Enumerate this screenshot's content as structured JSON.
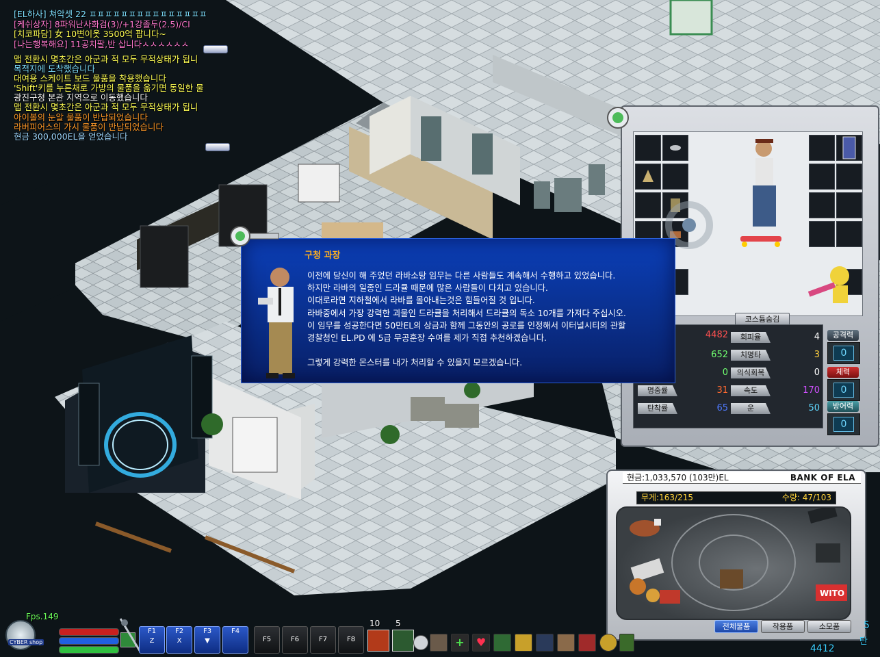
{
  "chat": {
    "player_lines": [
      {
        "text": "[EL하사] 쳐악셋 22 ㅍㅍㅍㅍㅍㅍㅍㅍㅍㅍㅍㅍㅍㅍㅍ",
        "color": "#7fe0ff"
      },
      {
        "text": "[케쉬상자] 8파워난사화검(3)/+1강졸두(2.5)/CI",
        "color": "#ff7ad0"
      },
      {
        "text": "[치코파담] 女 10변이옷 3500억 팝니다~",
        "color": "#ffff55"
      },
      {
        "text": "[나는행복해요] 11공치팔,반 삽니다ㅅㅅㅅㅅㅅㅅ",
        "color": "#ff7ad0"
      }
    ],
    "system_lines": [
      {
        "text": "맵 전환시 몇초간은 아군과 적 모두 무적상태가 됩니",
        "color": "#ffff55"
      },
      {
        "text": "목적지에 도착했습니다",
        "color": "#7fe0ff"
      },
      {
        "text": "대여용 스케이트 보드 물품을 착용했습니다",
        "color": "#ffff55"
      },
      {
        "text": "'Shift'키를 누른채로 가방의 물품을 옮기면 동일한 물",
        "color": "#ffff55"
      },
      {
        "text": "광진구청 본관 지역으로 이동했습니다",
        "color": "#ffffff"
      },
      {
        "text": "맵 전환시 몇초간은 아군과 적 모두 무적상태가 됩니",
        "color": "#ffff55"
      },
      {
        "text": "아이볼의 눈알 물품이 반납되었습니다",
        "color": "#ff9a2a"
      },
      {
        "text": "라버피어스의 가시 물품이 반납되었습니다",
        "color": "#ff9a2a"
      },
      {
        "text": "현금 300,000EL을 얻었습니다",
        "color": "#9fd8ff"
      }
    ]
  },
  "quest_dialog": {
    "title": "구청 과장",
    "lines": [
      "이전에 당신이 해 주었던 라바소탕 임무는 다른 사람들도 계속해서 수행하고 있었습니다.",
      "하지만 라바의 일종인 드라큘 때문에 많은 사람들이 다치고 있습니다.",
      "이대로라면 지하철에서 라바를 몰아내는것은 힘들어질 것 입니다.",
      "라바중에서 가장 강력한 괴물인 드라큘을 처리해서 드라큘의 독소 10개를 가져다 주십시오.",
      "이 임무를 성공한다면 50만EL의 상금과 함께 그동안의 공로를 인정해서 이터널시티의 관할",
      "경찰청인 EL.PD 에 5급 무공훈장 수여를 제가 직접 추천하겠습니다.",
      "",
      "그렇게 강력한 몬스터를 내가 처리할 수 있을지 모르겠습니다."
    ]
  },
  "character_window": {
    "costume_button": "코스튬숨김",
    "left_stats": [
      {
        "label": "",
        "value": "4482",
        "color": "#ff5050"
      },
      {
        "label": "",
        "value": "652",
        "color": "#70ff70"
      },
      {
        "label": "",
        "value": "0",
        "color": "#70ff70"
      },
      {
        "label": "명중률",
        "value": "31",
        "color": "#ff6a30"
      },
      {
        "label": "탄착률",
        "value": "65",
        "color": "#4f7aff"
      }
    ],
    "mid_stats": [
      {
        "label": "회피율",
        "value": "4",
        "color": "#ffffff"
      },
      {
        "label": "치명타",
        "value": "3",
        "color": "#ffd040"
      },
      {
        "label": "의식회복",
        "value": "0",
        "color": "#ffffff"
      },
      {
        "label": "속도",
        "value": "170",
        "color": "#d050ff"
      },
      {
        "label": "운",
        "value": "50",
        "color": "#60d8ff"
      }
    ],
    "right_stats": [
      {
        "label": "공격력",
        "value": "0"
      },
      {
        "label": "체력",
        "value": "0"
      },
      {
        "label": "방어력",
        "value": "0"
      }
    ]
  },
  "bank_window": {
    "money": "현금:1,033,570 (103만)EL",
    "name": "BANK OF ELA",
    "weight": "무게:163/215",
    "count": "수량: 47/103",
    "tabs": [
      "전체물품",
      "착용품",
      "소모품"
    ],
    "active_tab": 0,
    "sign_text": "WITO"
  },
  "hud": {
    "fps": "Fps.149",
    "shop_label": "CYBER shop",
    "fkeys": [
      {
        "key": "F1",
        "sub": "Z"
      },
      {
        "key": "F2",
        "sub": "X"
      },
      {
        "key": "F3",
        "sub": "▼"
      },
      {
        "key": "F4",
        "sub": ""
      },
      {
        "key": "F5",
        "sub": ""
      },
      {
        "key": "F6",
        "sub": ""
      },
      {
        "key": "F7",
        "sub": ""
      },
      {
        "key": "F8",
        "sub": ""
      }
    ],
    "item_count_1": "10",
    "item_count_2": "5",
    "side_text_1": "5",
    "side_text_2": "탄",
    "bottom_number": "4412",
    "quick_icons": [
      "box-icon",
      "plus-icon",
      "heart-icon",
      "chat-icon",
      "puzzle-icon",
      "gear-icon",
      "handshake-icon",
      "flag-icon",
      "medal-icon",
      "grid-icon"
    ]
  }
}
